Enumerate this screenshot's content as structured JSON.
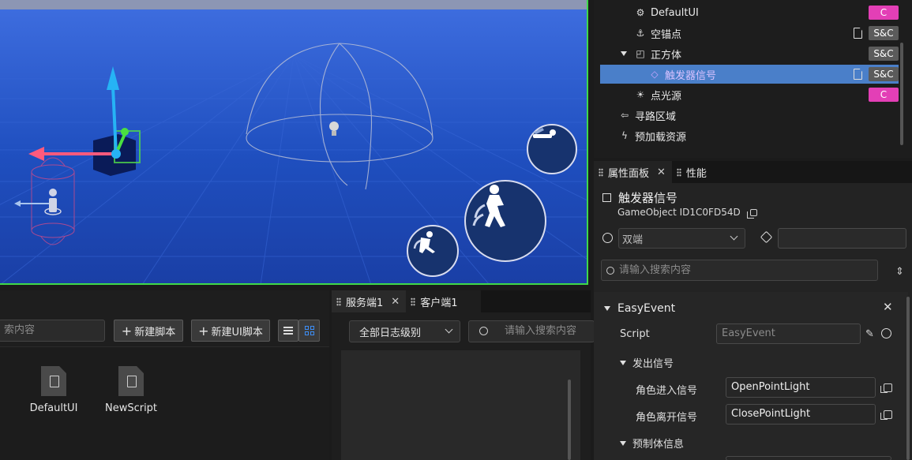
{
  "hierarchy": {
    "items": [
      {
        "label": "DefaultUI",
        "icon": "ui-component-icon",
        "badge": "C",
        "file": false
      },
      {
        "label": "空锚点",
        "icon": "anchor-icon",
        "badge": "S&C",
        "file": true
      },
      {
        "label": "正方体",
        "icon": "cube-icon",
        "badge": "S&C",
        "file": false
      },
      {
        "label": "触发器信号",
        "icon": "trigger-icon",
        "badge": "S&C",
        "file": true
      },
      {
        "label": "点光源",
        "icon": "point-light-icon",
        "badge": "C",
        "file": false
      },
      {
        "label": "寻路区域",
        "icon": "signpost-icon",
        "badge": "",
        "file": false
      },
      {
        "label": "预加载资源",
        "icon": "lightning-icon",
        "badge": "",
        "file": false
      }
    ]
  },
  "props_tabs": [
    {
      "label": "属性面板"
    },
    {
      "label": "性能"
    }
  ],
  "object": {
    "name": "触发器信号",
    "id_label": "GameObject ID",
    "id_value": "1C0FD54D",
    "scope": "双端",
    "tag_value": "",
    "search_placeholder": "请输入搜索内容"
  },
  "component": {
    "name": "EasyEvent",
    "script_label": "Script",
    "script_value": "EasyEvent",
    "send_group": "发出信号",
    "enter_label": "角色进入信号",
    "enter_value": "OpenPointLight",
    "leave_label": "角色离开信号",
    "leave_value": "ClosePointLight",
    "prefab_group": "预制体信息"
  },
  "assets": {
    "search_placeholder": "索内容",
    "new_script": "新建脚本",
    "new_ui_script": "新建UI脚本",
    "files": [
      {
        "label": "DefaultUI"
      },
      {
        "label": "NewScript"
      }
    ]
  },
  "console": {
    "tabs": [
      {
        "label": "服务端1"
      },
      {
        "label": "客户端1"
      }
    ],
    "level": "全部日志级别",
    "search_placeholder": "请输入搜索内容"
  },
  "colors": {
    "selection": "#4a7fc9",
    "badge_client": "#e33fb6",
    "badge_both": "#5b5b5b",
    "viewport_border": "#3fd84a"
  }
}
